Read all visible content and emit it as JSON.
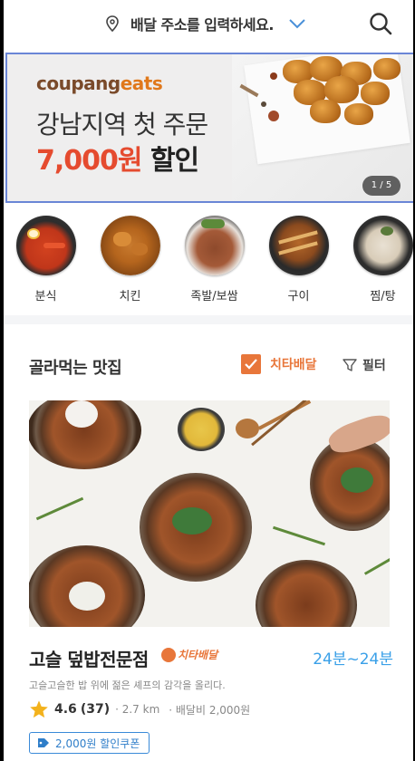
{
  "header": {
    "address_prompt": "배달 주소를 입력하세요."
  },
  "banner": {
    "logo_part1": "coupang",
    "logo_part2": "eats",
    "line1": "강남지역 첫 주문",
    "amount": "7,000원",
    "discount_word": "할인",
    "pager": "1 / 5"
  },
  "categories": [
    {
      "label": "분식"
    },
    {
      "label": "치킨"
    },
    {
      "label": "족발/보쌈"
    },
    {
      "label": "구이"
    },
    {
      "label": "찜/탕"
    }
  ],
  "section": {
    "title": "골라먹는 맛집",
    "cheetah_filter": "치타배달",
    "filter": "필터"
  },
  "restaurant": {
    "name": "고슬 덮밥전문점",
    "badge": "치타배달",
    "eta": "24분~24분",
    "description": "고슬고슬한 밥 위에 젊은 셰프의 감각을 올리다.",
    "rating": "4.6",
    "reviews": "(37)",
    "distance": "· 2.7 km",
    "delivery_fee": "· 배달비 2,000원",
    "coupon": "2,000원 할인쿠폰"
  },
  "colors": {
    "accent_orange": "#e8763a",
    "eta_blue": "#3aa0e8",
    "price_red": "#e54b2f",
    "coupon_blue": "#2f7ec9"
  }
}
